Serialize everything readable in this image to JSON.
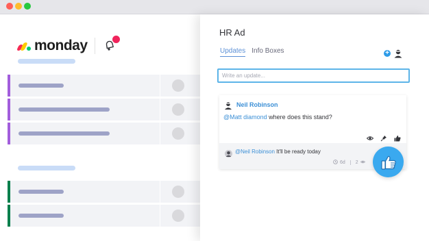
{
  "window": {
    "controls": [
      "close",
      "minimize",
      "maximize"
    ]
  },
  "brand": {
    "name": "monday",
    "colors": {
      "red": "#f62b54",
      "yellow": "#ffcc00",
      "green": "#00ca72"
    }
  },
  "board": {
    "groups": [
      {
        "color": "#a25ddc",
        "rows": 3
      },
      {
        "color": "#037f4c",
        "rows": 2
      }
    ]
  },
  "panel": {
    "title": "HR Ad",
    "tabs": [
      {
        "label": "Updates",
        "active": true
      },
      {
        "label": "Info Boxes",
        "active": false
      }
    ],
    "input_placeholder": "Write an update...",
    "post": {
      "author": "Neil Robinson",
      "mention": "@Matt diamond",
      "text": " where does this stand?"
    },
    "reply": {
      "mention": "@Neil Robinson",
      "text": " It'll be ready today",
      "age": "6d",
      "views": "2"
    },
    "accent": "#3b8fd6"
  }
}
